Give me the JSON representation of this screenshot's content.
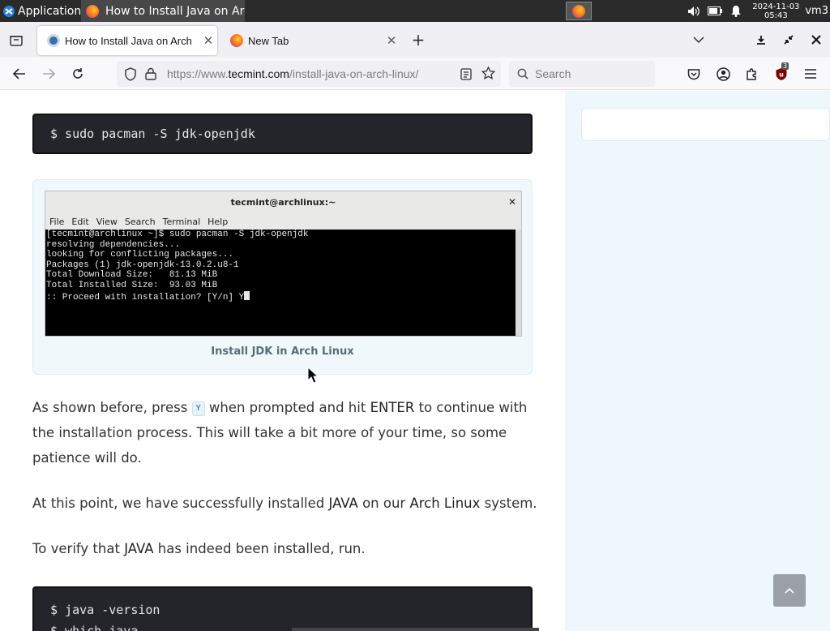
{
  "os_panel": {
    "apps_label": "Applications",
    "task_title": "How to Install Java on Arc...",
    "clock_date": "2024-11-03",
    "clock_time": "05:43",
    "user": "vm3"
  },
  "tabs": [
    {
      "label": "How to Install Java on Arch",
      "active": true
    },
    {
      "label": "New Tab",
      "active": false
    }
  ],
  "navbar": {
    "url_prefix": "https://www.",
    "url_host": "tecmint.com",
    "url_path": "/install-java-on-arch-linux/",
    "search_placeholder": "Search",
    "extension_badge": "3"
  },
  "article": {
    "code1": "$ sudo pacman -S jdk-openjdk",
    "figure": {
      "title": "tecmint@archlinux:~",
      "menu": [
        "File",
        "Edit",
        "View",
        "Search",
        "Terminal",
        "Help"
      ],
      "lines": [
        "[tecmint@archlinux ~]$ sudo pacman -S jdk-openjdk",
        "resolving dependencies...",
        "looking for conflicting packages...",
        "",
        "Packages (1) jdk-openjdk-13.0.2.u8-1",
        "",
        "Total Download Size:   81.13 MiB",
        "Total Installed Size:  93.03 MiB",
        "",
        ":: Proceed with installation? [Y/n] Y"
      ],
      "caption": "Install JDK in Arch Linux"
    },
    "p1_before": "As shown before, press ",
    "p1_key": "Y",
    "p1_middle": " when prompted and hit ",
    "p1_enter": "ENTER",
    "p1_after": " to continue with the installation process. This will take a bit more of your time, so some patience will do.",
    "p2_before": "At this point, we have successfully installed ",
    "p2_java": "JAVA",
    "p2_middle": " on our ",
    "p2_arch": "Arch Linux",
    "p2_after": " system.",
    "p3_before": "To verify that ",
    "p3_java": "JAVA",
    "p3_after": " has indeed been installed, run.",
    "code2_lines": [
      "$ java -version",
      "$ which java"
    ]
  }
}
